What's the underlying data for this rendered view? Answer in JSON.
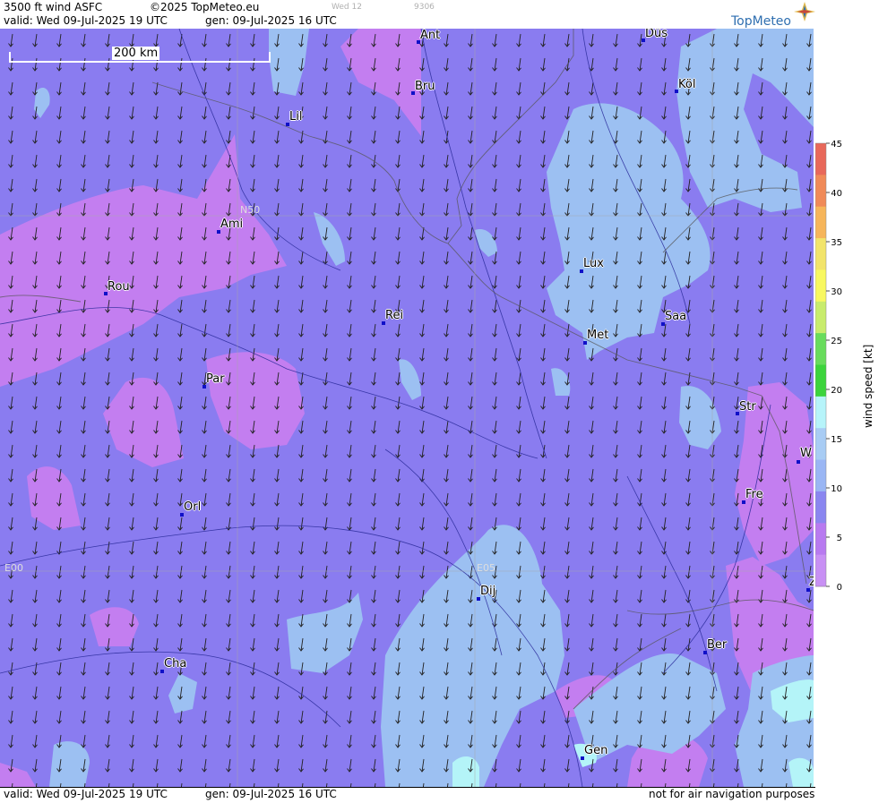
{
  "header": {
    "product": "3500 ft wind ASFC",
    "copyright": "©2025 TopMeteo.eu",
    "faint_day": "Wed 12",
    "faint_code": "9306",
    "valid_line": "valid:  Wed  09-Jul-2025  19 UTC",
    "gen_line": "gen:  09-Jul-2025 16 UTC",
    "logo_text": "TopMeteo"
  },
  "footer": {
    "valid_line": "valid:  Wed  09-Jul-2025  19 UTC",
    "gen_line": "gen:  09-Jul-2025 16 UTC",
    "disclaimer": "not for air navigation purposes"
  },
  "scale": {
    "label": "200 km"
  },
  "grid_labels": {
    "n50": "N50",
    "e00": "E00",
    "e05": "E05"
  },
  "cities": [
    {
      "name": "Ant"
    },
    {
      "name": "Düs"
    },
    {
      "name": "Bru"
    },
    {
      "name": "Köl"
    },
    {
      "name": "Lil"
    },
    {
      "name": "Ami"
    },
    {
      "name": "Rou"
    },
    {
      "name": "Lux"
    },
    {
      "name": "Rei"
    },
    {
      "name": "Saa"
    },
    {
      "name": "Met"
    },
    {
      "name": "Par"
    },
    {
      "name": "Str"
    },
    {
      "name": "W"
    },
    {
      "name": "Fre"
    },
    {
      "name": "Orl"
    },
    {
      "name": "Dij"
    },
    {
      "name": "Ber"
    },
    {
      "name": "Cha"
    },
    {
      "name": "Gen"
    },
    {
      "name": "Z"
    }
  ],
  "legend": {
    "title": "wind  speed  [kt]",
    "ticks": [
      "45",
      "40",
      "35",
      "30",
      "25",
      "20",
      "15",
      "10",
      "5",
      "0"
    ],
    "colors": [
      "#e8685a",
      "#f08a58",
      "#f6b55a",
      "#f2e46a",
      "#f8f860",
      "#c8ec6c",
      "#68dc5c",
      "#3cd43c",
      "#b6f4fa",
      "#a8ccf4",
      "#9ab6f4",
      "#8a86f0",
      "#b87af0",
      "#c890f4"
    ]
  },
  "map_colors": {
    "base": "#8a7cf0",
    "calm": "#c37ef0",
    "moderate": "#9cc0f2",
    "fresh": "#b4f4f8"
  }
}
